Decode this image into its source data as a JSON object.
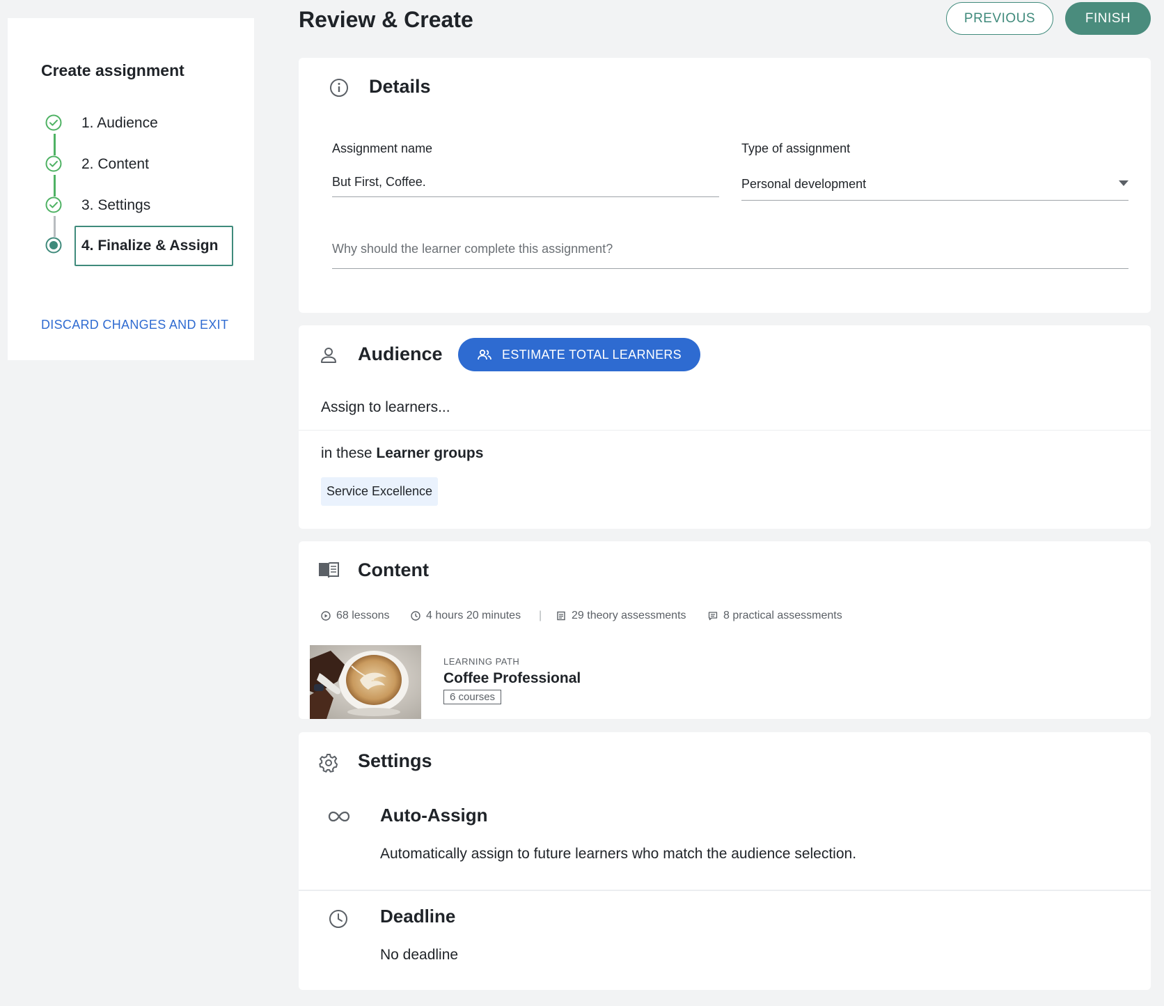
{
  "sidebar": {
    "title": "Create assignment",
    "steps": [
      {
        "label": "1. Audience",
        "status": "complete"
      },
      {
        "label": "2. Content",
        "status": "complete"
      },
      {
        "label": "3. Settings",
        "status": "complete"
      },
      {
        "label": "4. Finalize & Assign",
        "status": "current"
      }
    ],
    "discard_label": "DISCARD CHANGES AND EXIT"
  },
  "header": {
    "title": "Review & Create",
    "previous_label": "PREVIOUS",
    "finish_label": "FINISH"
  },
  "details": {
    "heading": "Details",
    "assignment_name_label": "Assignment name",
    "assignment_name_value": "But First, Coffee.",
    "type_label": "Type of assignment",
    "type_value": "Personal development",
    "reason_placeholder": "Why should the learner complete this assignment?"
  },
  "audience": {
    "heading": "Audience",
    "estimate_label": "ESTIMATE TOTAL LEARNERS",
    "assign_text": "Assign to learners...",
    "groups_prefix": "in these ",
    "groups_label": "Learner groups",
    "groups": [
      "Service Excellence"
    ]
  },
  "content": {
    "heading": "Content",
    "stats": {
      "lessons": "68 lessons",
      "duration": "4 hours 20 minutes",
      "theory": "29 theory assessments",
      "practical": "8 practical assessments"
    },
    "item": {
      "kicker": "LEARNING PATH",
      "title": "Coffee Professional",
      "badge": "6 courses"
    }
  },
  "settings": {
    "heading": "Settings",
    "auto_assign": {
      "heading": "Auto-Assign",
      "text": "Automatically assign to future learners who match the audience selection."
    },
    "deadline": {
      "heading": "Deadline",
      "text": "No deadline"
    }
  },
  "colors": {
    "accent_green": "#3f8a7b",
    "check_green": "#4fb264",
    "primary_blue": "#2e6bd1",
    "background": "#f2f3f4"
  }
}
